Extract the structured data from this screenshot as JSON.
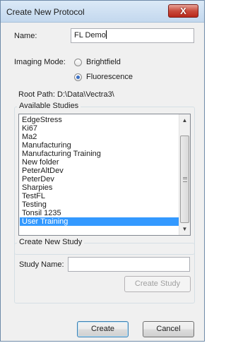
{
  "window": {
    "title": "Create New Protocol",
    "close_glyph": "X"
  },
  "form": {
    "name_label": "Name:",
    "name_value": "FL Demo",
    "imaging_mode_label": "Imaging Mode:",
    "modes": [
      {
        "label": "Brightfield",
        "selected": false
      },
      {
        "label": "Fluorescence",
        "selected": true
      }
    ],
    "root_path": "Root Path: D:\\Data\\Vectra3\\"
  },
  "studies": {
    "group_label": "Available Studies",
    "items": [
      "EdgeStress",
      "Ki67",
      "Ma2",
      "Manufacturing",
      "Manufacturing Training",
      "New folder",
      "PeterAltDev",
      "PeterDev",
      "Sharpies",
      "TestFL",
      "Testing",
      "Tonsil 1235",
      "User Training"
    ],
    "selected_item": "User Training",
    "scroll_up_glyph": "▲",
    "scroll_down_glyph": "▼"
  },
  "new_study": {
    "group_label": "Create New Study",
    "study_name_label": "Study Name:",
    "study_name_value": "",
    "create_study_label": "Create Study"
  },
  "buttons": {
    "create_label": "Create",
    "cancel_label": "Cancel"
  }
}
